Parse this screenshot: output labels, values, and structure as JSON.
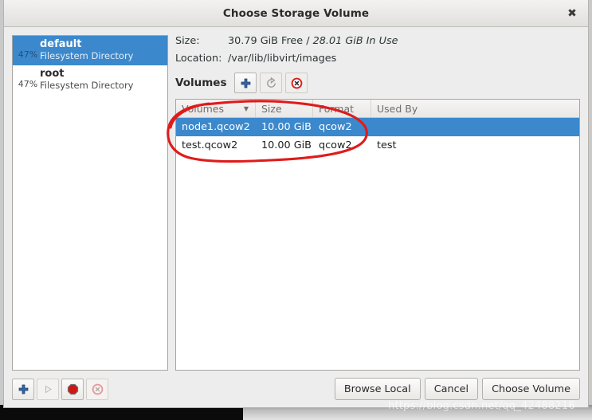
{
  "window": {
    "title": "Choose Storage Volume",
    "close_icon": "close-icon",
    "close_glyph": "✖"
  },
  "pools": {
    "items": [
      {
        "percent": "47%",
        "name": "default",
        "type": "Filesystem Directory",
        "selected": true
      },
      {
        "percent": "47%",
        "name": "root",
        "type": "Filesystem Directory",
        "selected": false
      }
    ]
  },
  "details": {
    "size_label": "Size:",
    "size_free": "30.79 GiB Free /",
    "size_inuse": "28.01 GiB In Use",
    "location_label": "Location:",
    "location_value": "/var/lib/libvirt/images"
  },
  "volumes_toolbar": {
    "title": "Volumes",
    "buttons": [
      {
        "name": "add-volume-button",
        "icon": "plus-icon"
      },
      {
        "name": "refresh-volumes-button",
        "icon": "refresh-icon"
      },
      {
        "name": "delete-volume-button",
        "icon": "delete-circle-icon"
      }
    ]
  },
  "volumes_table": {
    "columns": [
      "Volumes",
      "Size",
      "Format",
      "Used By"
    ],
    "sort_glyph": "▼",
    "rows": [
      {
        "name": "node1.qcow2",
        "size": "10.00 GiB",
        "format": "qcow2",
        "used_by": "",
        "selected": true
      },
      {
        "name": "test.qcow2",
        "size": "10.00 GiB",
        "format": "qcow2",
        "used_by": "test",
        "selected": false
      }
    ]
  },
  "footer": {
    "left_buttons": [
      {
        "name": "add-pool-button",
        "icon": "plus-icon",
        "disabled": false
      },
      {
        "name": "start-pool-button",
        "icon": "play-icon",
        "disabled": true
      },
      {
        "name": "stop-pool-button",
        "icon": "stop-icon",
        "disabled": false
      },
      {
        "name": "delete-pool-button",
        "icon": "delete-circle-icon",
        "disabled": true
      }
    ],
    "browse_local": "Browse Local",
    "cancel": "Cancel",
    "choose_volume": "Choose Volume"
  },
  "annotation": {
    "type": "hand-drawn-ellipse",
    "color": "#e01b1b",
    "target": "node1.qcow2 row"
  },
  "watermark": {
    "text": "https://blog.csdn.net/qq_42488216"
  },
  "colors": {
    "selection_blue": "#3c88cc",
    "dialog_bg": "#ededed",
    "annotation_red": "#e01b1b"
  }
}
